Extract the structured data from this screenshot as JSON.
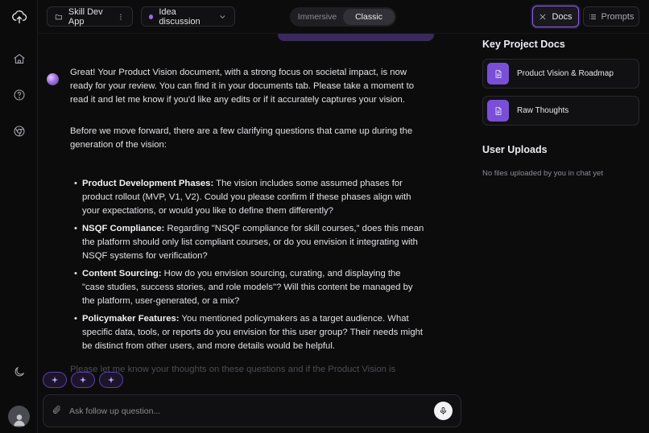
{
  "topbar": {
    "project_label": "Skill Dev App",
    "session_label": "Idea discussion",
    "view_modes": [
      "Immersive",
      "Classic"
    ],
    "active_view_mode": "Classic",
    "docs_label": "Docs",
    "prompts_label": "Prompts"
  },
  "chat": {
    "paragraph1": "Great! Your Product Vision document, with a strong focus on societal impact, is now ready for your review. You can find it in your documents tab. Please take a moment to read it and let me know if you'd like any edits or if it accurately captures your vision.",
    "paragraph2": "Before we move forward, there are a few clarifying questions that came up during the generation of the vision:",
    "questions": [
      {
        "title": "Product Development Phases:",
        "text": " The vision includes some assumed phases for product rollout (MVP, V1, V2). Could you please confirm if these phases align with your expectations, or would you like to define them differently?"
      },
      {
        "title": "NSQF Compliance:",
        "text": " Regarding \"NSQF compliance for skill courses,\" does this mean the platform should only list compliant courses, or do you envision it integrating with NSQF systems for verification?"
      },
      {
        "title": "Content Sourcing:",
        "text": " How do you envision sourcing, curating, and displaying the \"case studies, success stories, and role models\"? Will this content be managed by the platform, user-generated, or a mix?"
      },
      {
        "title": "Policymaker Features:",
        "text": " You mentioned policymakers as a target audience. What specific data, tools, or reports do you envision for this user group? Their needs might be distinct from other users, and more details would be helpful."
      }
    ],
    "trailing_text": "Please let me know your thoughts on these questions and if the Product Vision is"
  },
  "composer": {
    "placeholder": "Ask follow up question..."
  },
  "panel": {
    "docs_heading": "Key Project Docs",
    "docs": [
      {
        "label": "Product Vision & Roadmap"
      },
      {
        "label": "Raw Thoughts"
      }
    ],
    "uploads_heading": "User Uploads",
    "uploads_empty": "No files uploaded by you in chat yet"
  },
  "colors": {
    "accent": "#8e63e8",
    "doc_icon_bg": "#7a4fd8",
    "background": "#0c0c0d"
  }
}
